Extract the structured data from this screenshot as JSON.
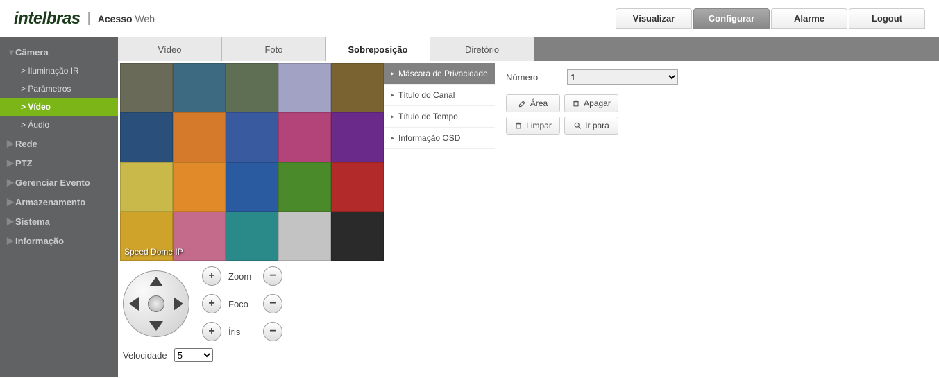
{
  "header": {
    "brand": "intelbras",
    "subtitle_bold": "Acesso",
    "subtitle_light": "Web"
  },
  "topnav": {
    "visualize": "Visualizar",
    "configure": "Configurar",
    "alarm": "Alarme",
    "logout": "Logout"
  },
  "sidebar": {
    "camera": "Câmera",
    "camera_children": {
      "ir": "Iluminação IR",
      "params": "Parâmetros",
      "video": "Vídeo",
      "audio": "Áudio"
    },
    "rede": "Rede",
    "ptz": "PTZ",
    "evento": "Gerenciar Evento",
    "armaz": "Armazenamento",
    "sistema": "Sistema",
    "info": "Informação"
  },
  "tabs": {
    "video": "Vídeo",
    "foto": "Foto",
    "sobrepos": "Sobreposição",
    "diretorio": "Diretório"
  },
  "preview": {
    "osd_text": "Speed Dome IP",
    "tile_colors": [
      "#6a6a59",
      "#3d6a80",
      "#5e6f53",
      "#a2a2c4",
      "#7a6330",
      "#2a4f7a",
      "#d47a2a",
      "#3a5aa0",
      "#b2447a",
      "#6a2a8a",
      "#c9b84a",
      "#e08a2a",
      "#2a5aa0",
      "#4a8a2a",
      "#b22a2a",
      "#cfa22a",
      "#c46a8a",
      "#2a8a8a",
      "#c3c3c3",
      "#2a2a2a"
    ]
  },
  "ptz_controls": {
    "zoom": "Zoom",
    "foco": "Foco",
    "iris": "Íris",
    "speed_label": "Velocidade",
    "speed_value": "5"
  },
  "submenu": {
    "mask": "Máscara de Privacidade",
    "channel": "Título do Canal",
    "time": "Título do Tempo",
    "osd": "Informação OSD"
  },
  "form": {
    "numero_label": "Número",
    "numero_value": "1",
    "area": "Área",
    "apagar": "Apagar",
    "limpar": "Limpar",
    "irpara": "Ir para"
  }
}
